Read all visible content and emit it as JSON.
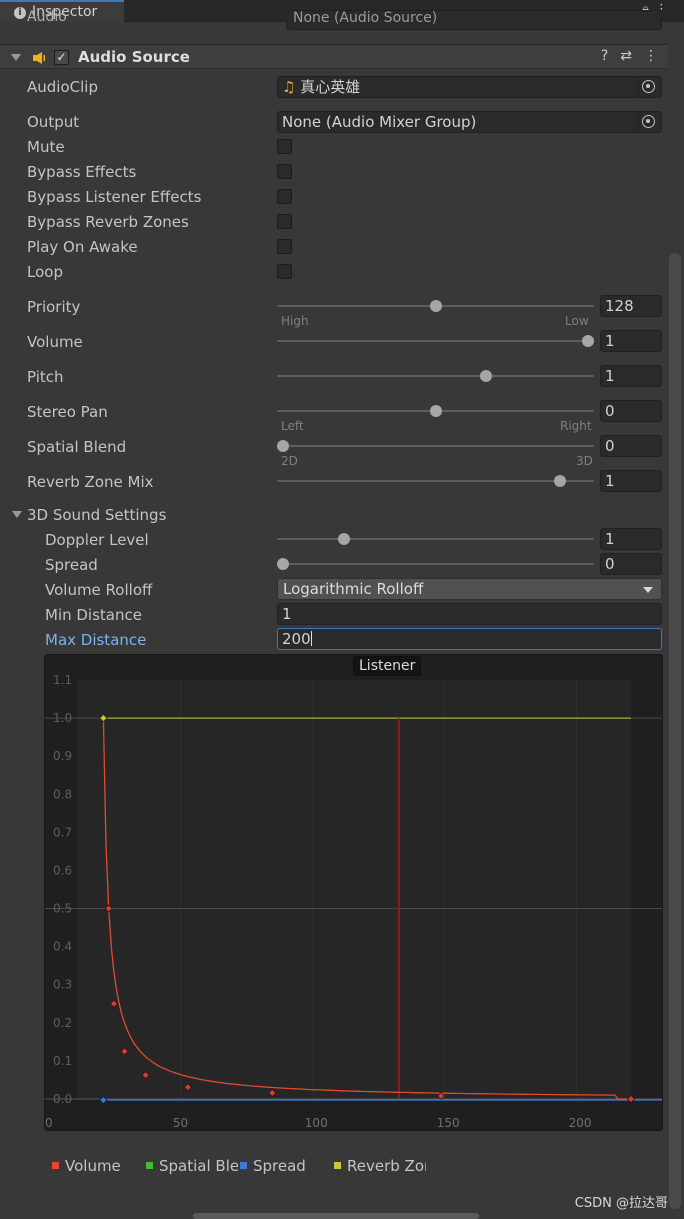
{
  "tab": {
    "title": "Inspector"
  },
  "prev_row": {
    "label": "Audio",
    "value": "None (Audio Source)"
  },
  "component": {
    "title": "Audio Source",
    "enabled": true
  },
  "fields": {
    "audio_clip": {
      "label": "AudioClip",
      "value": "真心英雄"
    },
    "output": {
      "label": "Output",
      "value": "None (Audio Mixer Group)"
    },
    "mute": {
      "label": "Mute",
      "checked": false
    },
    "bypass_effects": {
      "label": "Bypass Effects",
      "checked": false
    },
    "bypass_listener_effects": {
      "label": "Bypass Listener Effects",
      "checked": false
    },
    "bypass_reverb_zones": {
      "label": "Bypass Reverb Zones",
      "checked": false
    },
    "play_on_awake": {
      "label": "Play On Awake",
      "checked": false
    },
    "loop": {
      "label": "Loop",
      "checked": false
    }
  },
  "sliders": {
    "priority": {
      "label": "Priority",
      "value": "128",
      "fraction": 0.5,
      "min_label": "High",
      "max_label": "Low"
    },
    "volume": {
      "label": "Volume",
      "value": "1",
      "fraction": 1.0
    },
    "pitch": {
      "label": "Pitch",
      "value": "1",
      "fraction": 0.667
    },
    "stereo_pan": {
      "label": "Stereo Pan",
      "value": "0",
      "fraction": 0.5,
      "min_label": "Left",
      "max_label": "Right"
    },
    "spatial_blend": {
      "label": "Spatial Blend",
      "value": "0",
      "fraction": 0.0,
      "min_label": "2D",
      "max_label": "3D"
    },
    "reverb_zone_mix": {
      "label": "Reverb Zone Mix",
      "value": "1",
      "fraction": 0.909
    }
  },
  "sound3d": {
    "title": "3D Sound Settings",
    "doppler": {
      "label": "Doppler Level",
      "value": "1",
      "fraction": 0.2
    },
    "spread": {
      "label": "Spread",
      "value": "0",
      "fraction": 0.0
    },
    "rolloff": {
      "label": "Volume Rolloff",
      "value": "Logarithmic Rolloff"
    },
    "min_distance": {
      "label": "Min Distance",
      "value": "1"
    },
    "max_distance": {
      "label": "Max Distance",
      "value": "200"
    }
  },
  "graph": {
    "listener_label": "Listener",
    "y_ticks": [
      "1.1",
      "1.0",
      "0.9",
      "0.8",
      "0.7",
      "0.6",
      "0.5",
      "0.4",
      "0.3",
      "0.2",
      "0.1",
      "0.0"
    ],
    "x_ticks": [
      "0",
      "50",
      "100",
      "150",
      "200"
    ],
    "listener_distance": 122,
    "volume_curve": [
      [
        10,
        1.0
      ],
      [
        12,
        0.5
      ],
      [
        14,
        0.25
      ],
      [
        18,
        0.125
      ],
      [
        26,
        0.0625
      ],
      [
        42,
        0.031
      ],
      [
        74,
        0.016
      ],
      [
        138,
        0.008
      ],
      [
        210,
        0.0
      ]
    ],
    "colors": {
      "volume": "#e04a2f",
      "spatial": "#3cbf2e",
      "spread": "#3a7ae0",
      "reverb": "#c7c92e",
      "listener": "#8a1e1e"
    }
  },
  "legend": [
    {
      "label": "Volume",
      "color": "#e04a2f"
    },
    {
      "label": "Spatial Ble",
      "color": "#3cbf2e"
    },
    {
      "label": "Spread",
      "color": "#3a7ae0"
    },
    {
      "label": "Reverb Zor",
      "color": "#c7c92e"
    }
  ],
  "watermark": "CSDN @拉达哥"
}
